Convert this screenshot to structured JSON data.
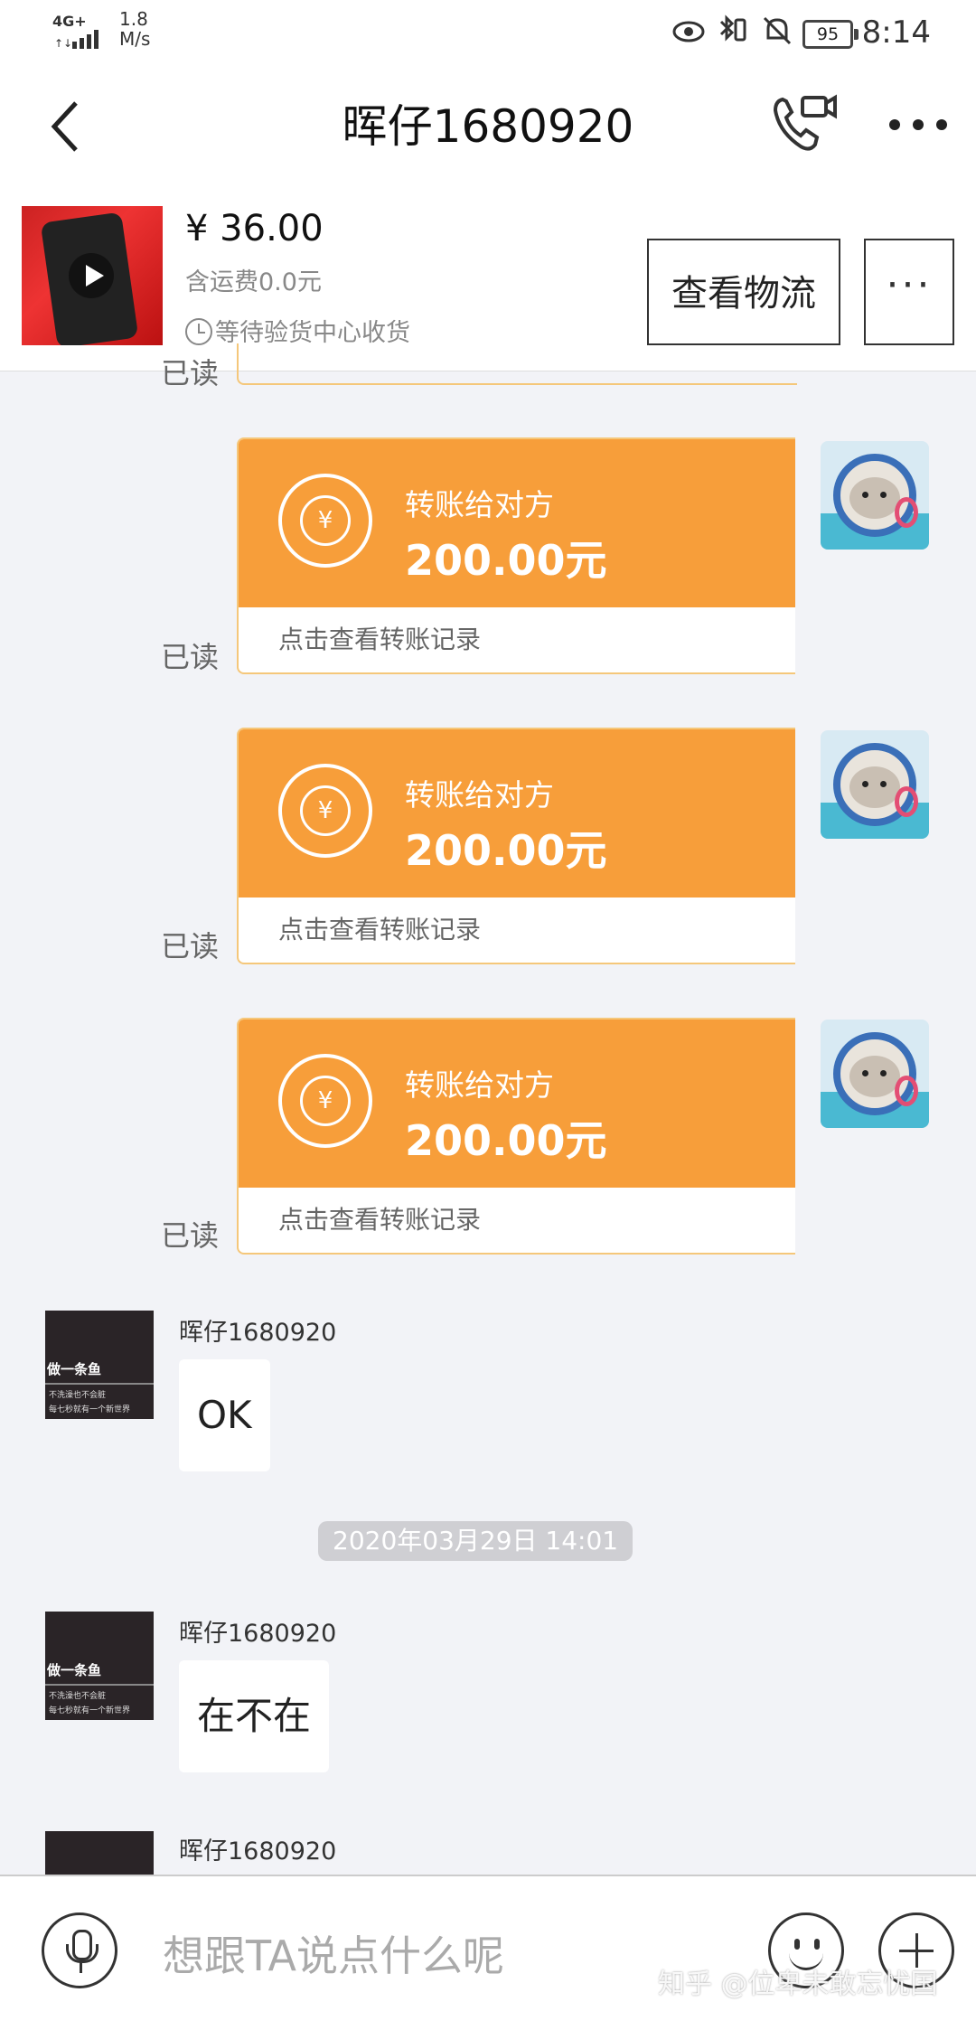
{
  "status_bar": {
    "network": "4G+",
    "speed_value": "1.8",
    "speed_unit": "M/s",
    "battery": "95",
    "time": "8:14"
  },
  "nav": {
    "title": "晖仔1680920",
    "back_icon": "chevron-left-icon",
    "call_icon": "phone-video-icon",
    "more_icon": "more-dots-icon"
  },
  "product": {
    "price": "¥ 36.00",
    "shipping": "含运费0.0元",
    "status": "等待验货中心收货",
    "logistics_button": "查看物流",
    "more_button": "···"
  },
  "transfers": [
    {
      "label": "转账给对方",
      "amount": "200.00元",
      "record": "点击查看转账记录",
      "read": "已读"
    },
    {
      "label": "转账给对方",
      "amount": "200.00元",
      "record": "点击查看转账记录",
      "read": "已读"
    },
    {
      "label": "转账给对方",
      "amount": "200.00元",
      "record": "点击查看转账记录",
      "read": "已读"
    }
  ],
  "partial_read": "已读",
  "messages": [
    {
      "sender": "晖仔1680920",
      "text": "OK"
    },
    {
      "sender": "晖仔1680920",
      "text": "在不在"
    },
    {
      "sender": "晖仔1680920",
      "text": ""
    }
  ],
  "timestamp": "2020年03月29日 14:01",
  "avatar_text": {
    "line1": "做一条鱼",
    "line2": "不洗澡也不会脏",
    "line3": "每七秒就有一个新世界"
  },
  "input": {
    "placeholder": "想跟TA说点什么呢"
  },
  "watermark": "知乎 @位卑未敢忘忧国"
}
